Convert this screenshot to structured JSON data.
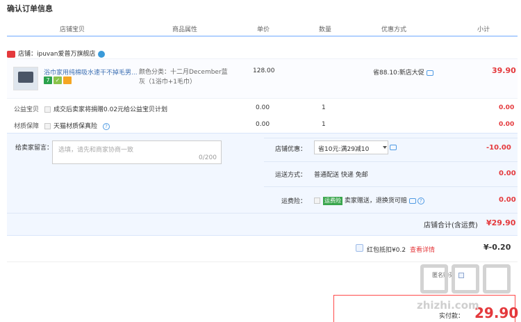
{
  "page": {
    "title": "确认订单信息"
  },
  "columns": [
    "店铺宝贝",
    "商品属性",
    "单价",
    "数量",
    "优惠方式",
    "小计"
  ],
  "shop": {
    "label": "店铺：ipuvan爱普万旗舰店"
  },
  "item": {
    "name": "浴巾家用纯棉吸水速干不掉毛男...",
    "badge_seven": "7",
    "badge_shield": "✓",
    "sku_line1": "颜色分类：十二月December蓝",
    "sku_line2": "灰（1浴巾+1毛巾）",
    "price": "128.00",
    "promo": "省88.10:新店大促",
    "subtotal": "39.90"
  },
  "services": [
    {
      "label": "公益宝贝",
      "desc": "成交后卖家将捐赠0.02元给公益宝贝计划",
      "price": "0.00",
      "qty": "1",
      "subtotal": "0.00"
    },
    {
      "label": "材质保障",
      "desc": "天猫材质保真险",
      "price": "0.00",
      "qty": "1",
      "subtotal": "0.00"
    }
  ],
  "message": {
    "label": "给卖家留言：",
    "placeholder": "选填，请先和商家协商一致",
    "count": "0/200"
  },
  "shop_coupon": {
    "label": "店铺优惠：",
    "selected": "省10元:满29减10",
    "amount": "-10.00"
  },
  "shipping": {
    "label": "运送方式：",
    "value": "普通配送 快递 免邮",
    "amount": "0.00"
  },
  "insurance": {
    "label": "运费险：",
    "badge": "运费险",
    "value": "卖家赠送，退换货可赔",
    "amount": "0.00"
  },
  "shop_total": {
    "label": "店铺合计(含运费)",
    "value": "¥29.90"
  },
  "redpacket": {
    "label": "红包抵扣¥0.2",
    "link": "查看详情",
    "value": "¥-0.20"
  },
  "anon": {
    "label": "匿名购买"
  },
  "payment": {
    "label": "实付款：",
    "value": "29.90"
  },
  "watermark": {
    "text": "zhizhi.com"
  },
  "colors": {
    "accent_red": "#e4393c",
    "header_line": "#b2d1ff",
    "panel_bg": "#f2f7ff",
    "link_blue": "#3c6fb3"
  }
}
